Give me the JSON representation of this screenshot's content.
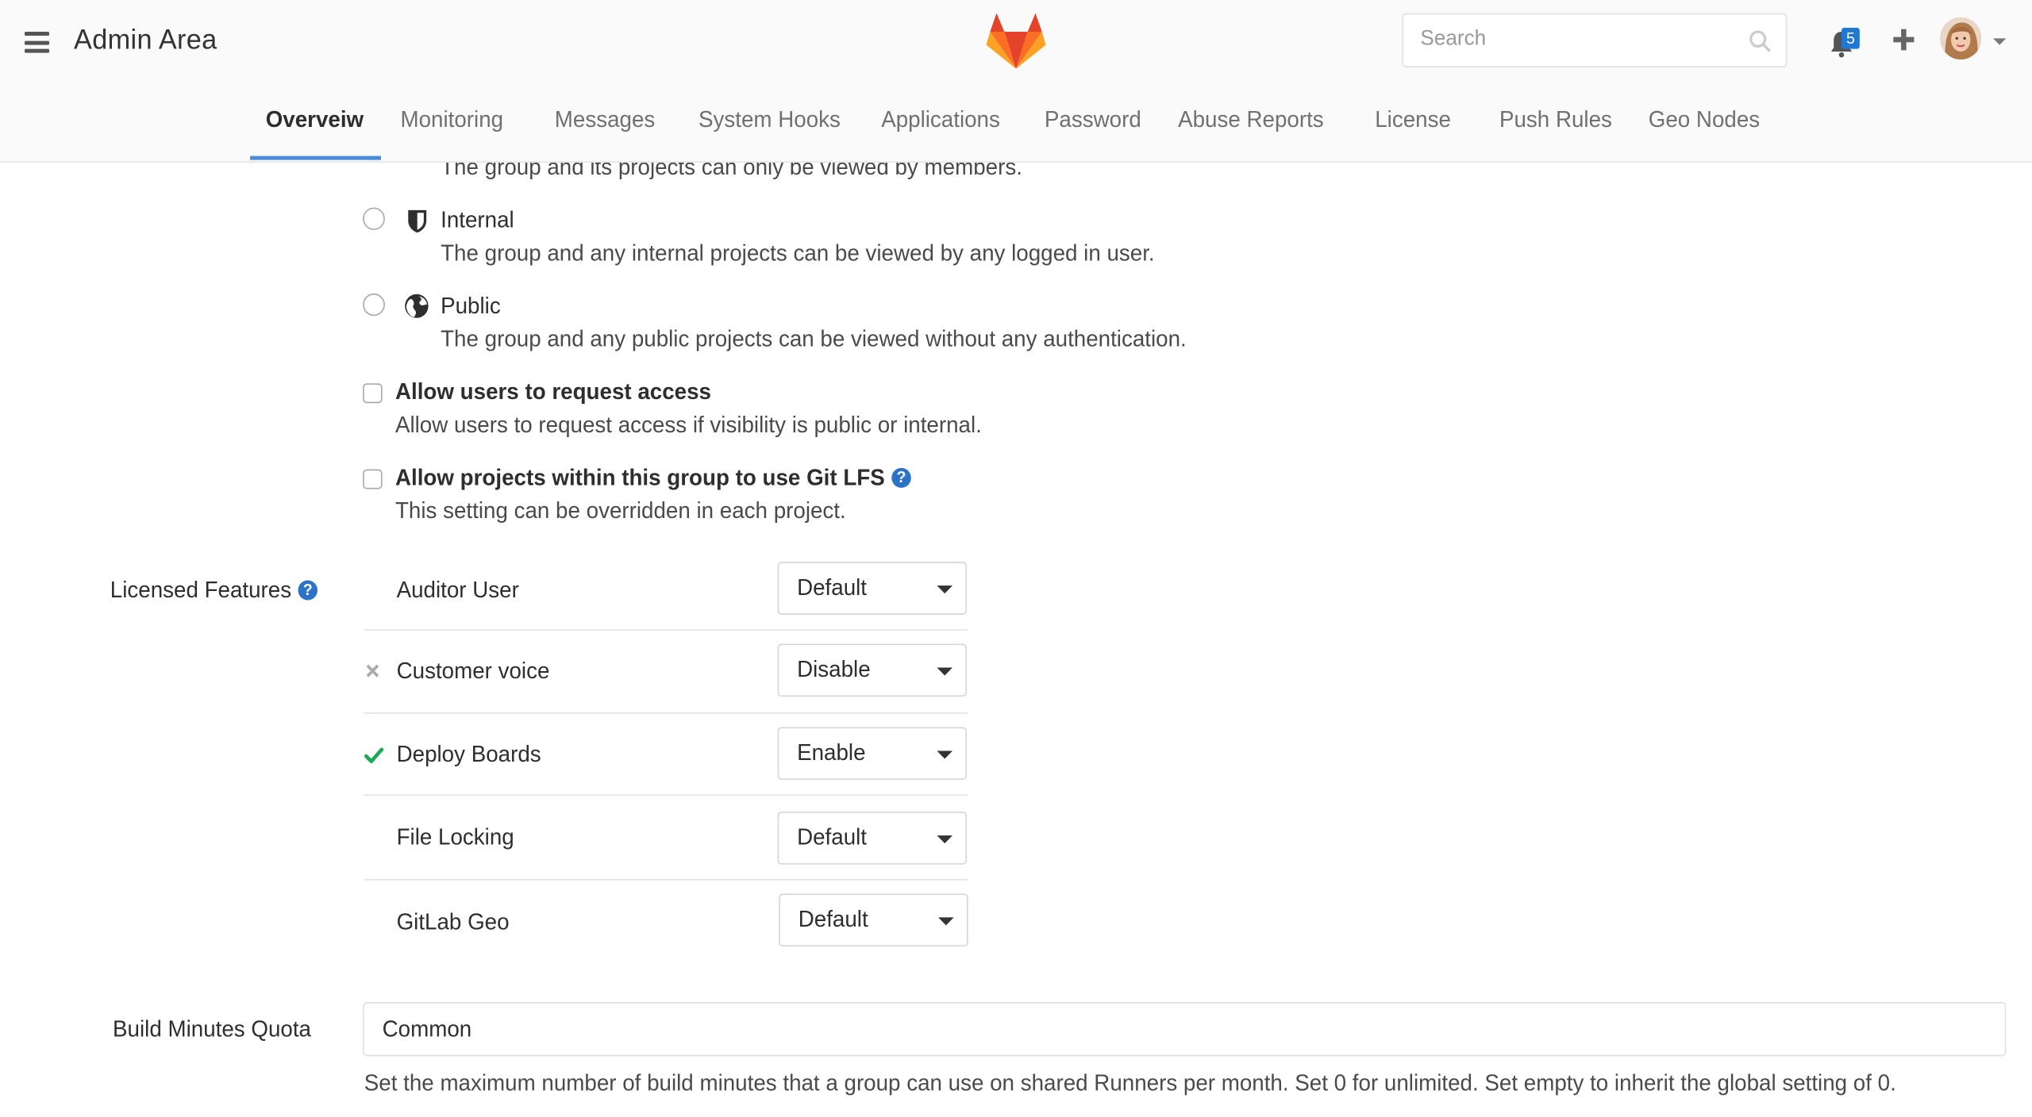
{
  "header": {
    "title": "Admin Area",
    "search": {
      "placeholder": "Search",
      "value": ""
    },
    "notifications_count": "5"
  },
  "tabs": [
    {
      "label": "Overveiw",
      "active": true
    },
    {
      "label": "Monitoring"
    },
    {
      "label": "Messages"
    },
    {
      "label": "System Hooks"
    },
    {
      "label": "Applications"
    },
    {
      "label": "Password"
    },
    {
      "label": "Abuse Reports"
    },
    {
      "label": "License"
    },
    {
      "label": "Push Rules"
    },
    {
      "label": "Geo Nodes"
    }
  ],
  "visibility": {
    "private_help": "The group and its projects can only be viewed by members.",
    "internal_label": "Internal",
    "internal_help": "The group and any internal projects can be viewed by any logged in user.",
    "public_label": "Public",
    "public_help": "The group and any public projects can be viewed without any authentication."
  },
  "request_access": {
    "label": "Allow users to request access",
    "help": "Allow users to request access if visibility is public or internal."
  },
  "git_lfs": {
    "label": "Allow projects within this group to use Git LFS",
    "help": "This setting can be overridden in each project."
  },
  "licensed_features": {
    "label": "Licensed Features",
    "features": [
      {
        "name": "Auditor User",
        "value": "Default",
        "status": ""
      },
      {
        "name": "Customer voice",
        "value": "Disable",
        "status": "disabled"
      },
      {
        "name": "Deploy Boards",
        "value": "Enable",
        "status": "enabled"
      },
      {
        "name": "File Locking",
        "value": "Default",
        "status": ""
      },
      {
        "name": "GitLab Geo",
        "value": "Default",
        "status": ""
      }
    ]
  },
  "build_minutes": {
    "label": "Build Minutes Quota",
    "value": "Common",
    "help": "Set the maximum number of build minutes that a group can use on shared Runners per month. Set 0 for unlimited. Set empty to inherit the global setting of 0."
  },
  "colors": {
    "accent": "#4a8bdb",
    "info": "#2c72c7",
    "success": "#1aaa55",
    "logo_orange": "#fc6d26",
    "logo_red": "#e24329",
    "logo_light": "#fca326"
  }
}
